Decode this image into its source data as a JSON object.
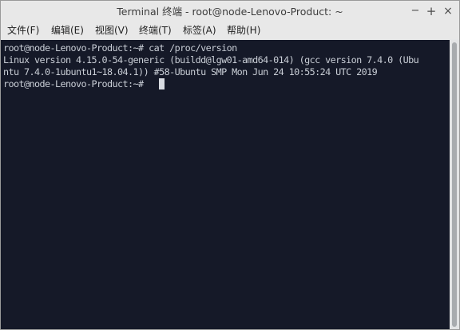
{
  "window": {
    "title": "Terminal 终端 - root@node-Lenovo-Product: ~",
    "controls": {
      "minimize": "−",
      "maximize": "+",
      "close": "×"
    }
  },
  "menubar": {
    "items": [
      {
        "label": "文件(F)"
      },
      {
        "label": "编辑(E)"
      },
      {
        "label": "视图(V)"
      },
      {
        "label": "终端(T)"
      },
      {
        "label": "标签(A)"
      },
      {
        "label": "帮助(H)"
      }
    ]
  },
  "terminal": {
    "lines": [
      "root@node-Lenovo-Product:~# cat /proc/version",
      "Linux version 4.15.0-54-generic (buildd@lgw01-amd64-014) (gcc version 7.4.0 (Ubu",
      "ntu 7.4.0-1ubuntu1~18.04.1)) #58-Ubuntu SMP Mon Jun 24 10:55:24 UTC 2019",
      "root@node-Lenovo-Product:~# "
    ],
    "colors": {
      "background": "#151928",
      "foreground": "#c9ced6"
    }
  }
}
